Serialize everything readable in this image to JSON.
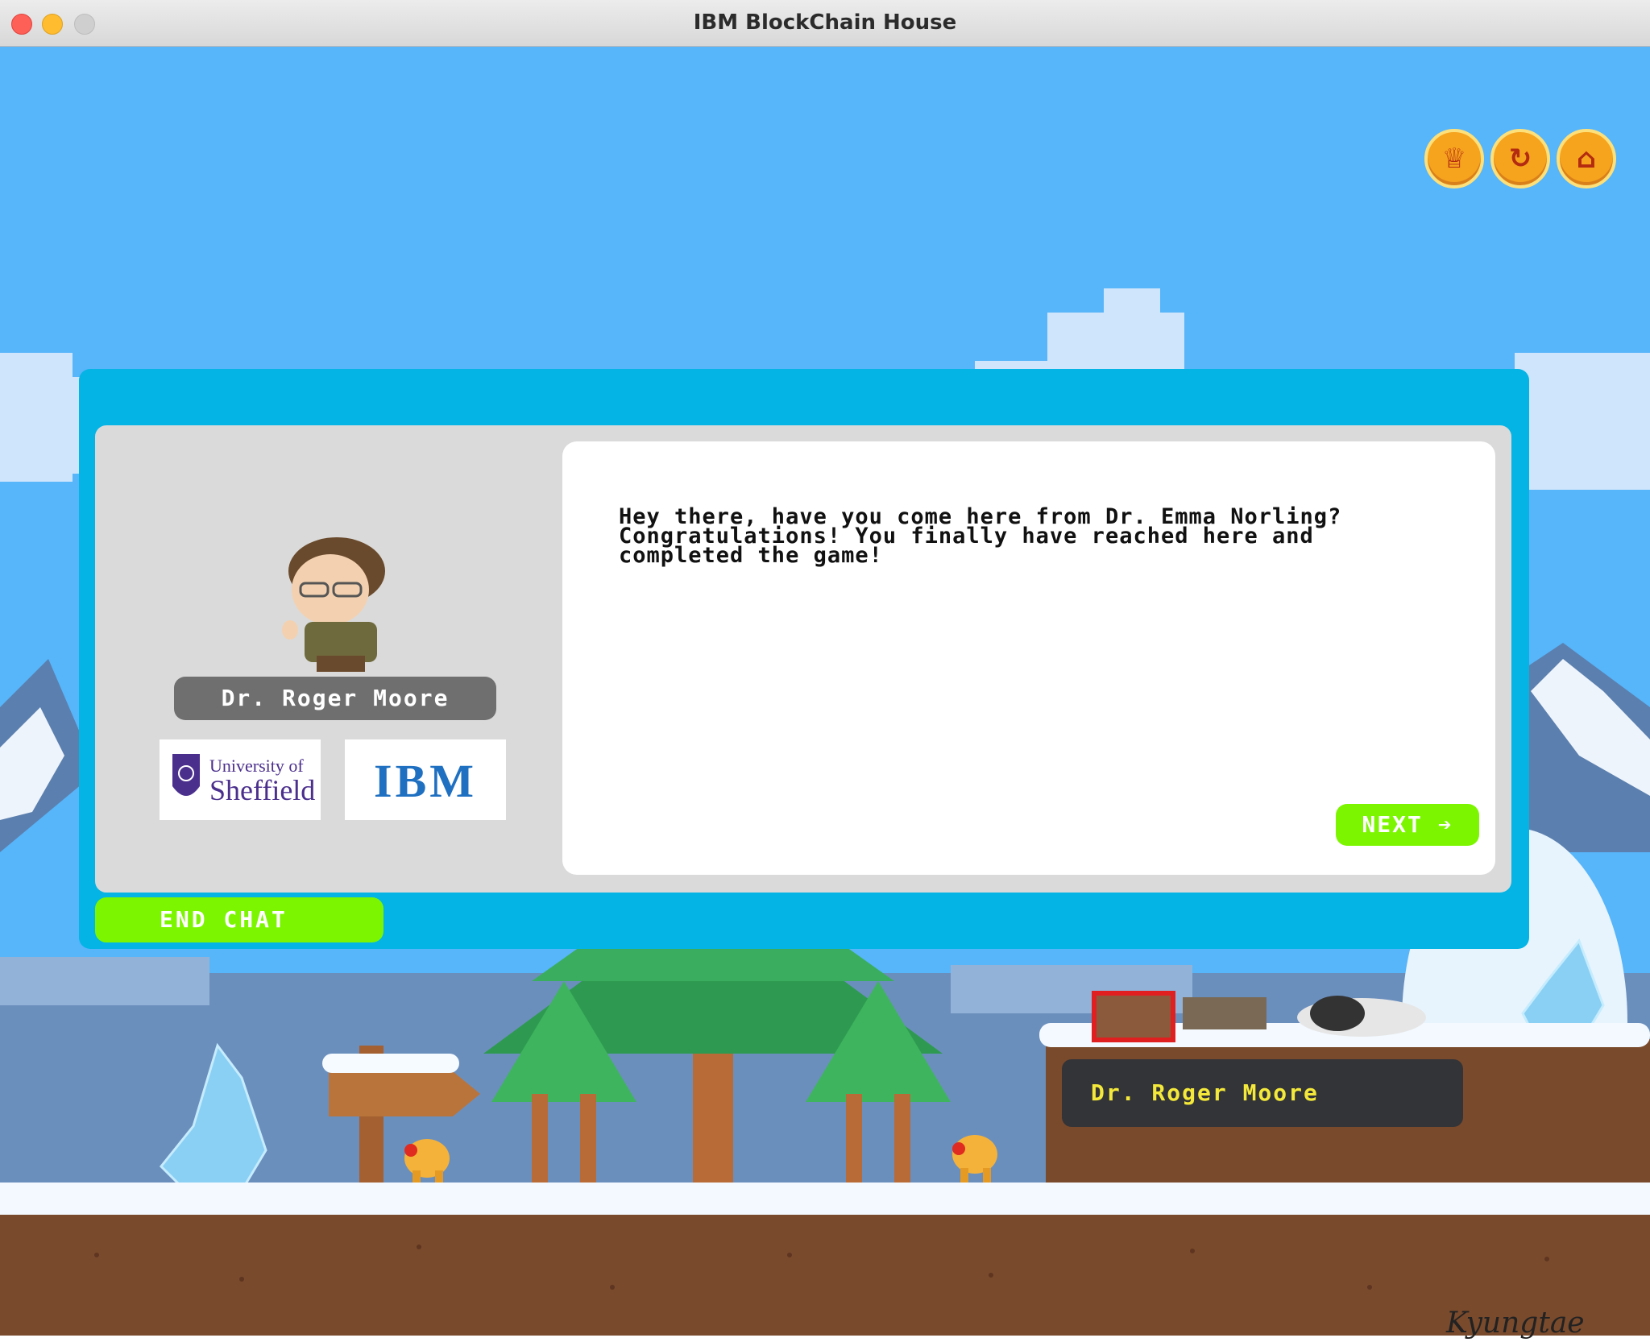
{
  "window": {
    "title": "IBM BlockChain House"
  },
  "controls": {
    "trophy_icon": "trophy-icon",
    "restart_icon": "restart-icon",
    "home_icon": "home-icon"
  },
  "dialog": {
    "speaker_name": "Dr. Roger Moore",
    "message": "Hey there, have you come here from Dr. Emma Norling? Congratulations! You finally have reached here and completed the game!",
    "next_label": "NEXT ➔",
    "end_chat_label": "END CHAT",
    "logos": {
      "sheffield_line1": "University of",
      "sheffield_line2": "Sheffield",
      "ibm": "IBM"
    }
  },
  "npc_label": "Dr. Roger Moore",
  "signature": "Kyungtae Han"
}
